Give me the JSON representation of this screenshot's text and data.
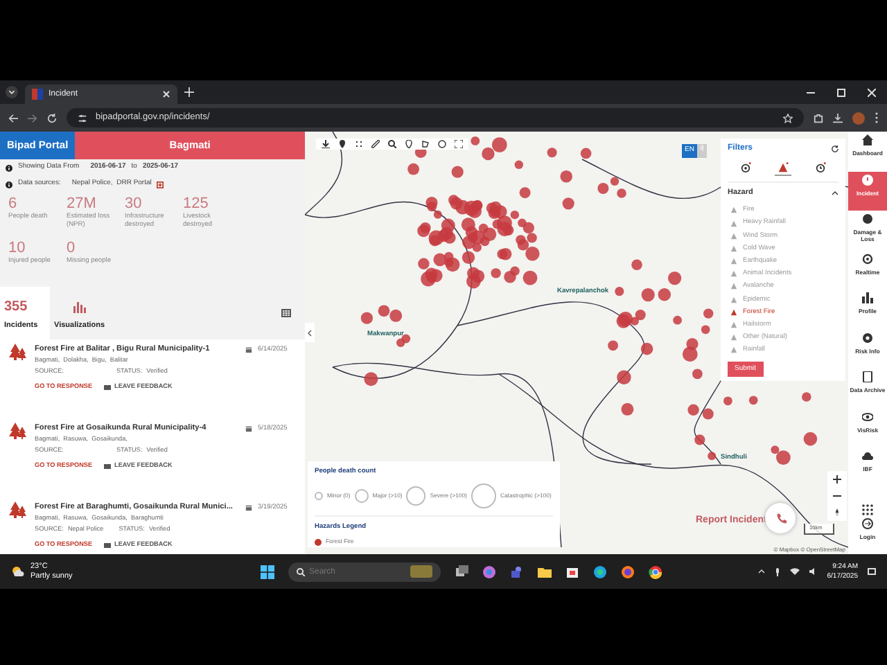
{
  "browser": {
    "tab_title": "Incident",
    "url": "bipadportal.gov.np/incidents/"
  },
  "header": {
    "brand": "Bipad Portal",
    "region": "Bagmati"
  },
  "date_range": {
    "label": "Showing Data From",
    "from": "2016-06-17",
    "to_label": "to",
    "to": "2025-06-17"
  },
  "data_sources": {
    "label": "Data sources:",
    "values": "Nepal Police,  DRR Portal"
  },
  "stats": [
    {
      "value": "6",
      "label": "People death"
    },
    {
      "value": "27M",
      "label": "Estimated loss (NPR)"
    },
    {
      "value": "30",
      "label": "Infrastructure destroyed"
    },
    {
      "value": "125",
      "label": "Livestock destroyed"
    },
    {
      "value": "10",
      "label": "Injured people"
    },
    {
      "value": "0",
      "label": "Missing people"
    }
  ],
  "tabs": [
    {
      "kind": "count",
      "value": "355",
      "label": "Incidents",
      "selected": true
    },
    {
      "kind": "chart",
      "label": "Visualizations",
      "selected": false
    }
  ],
  "incidents": [
    {
      "title": "Forest Fire at Balitar , Bigu Rural Municipality-1",
      "date": "6/14/2025",
      "location": "Bagmati,  Dolakha,  Bigu,  Balitar",
      "source_label": "SOURCE:",
      "status_label": "STATUS:",
      "status": "Verified",
      "response": "GO TO RESPONSE",
      "feedback": "LEAVE FEEDBACK"
    },
    {
      "title": "Forest Fire at Gosaikunda Rural Municipality-4",
      "date": "5/18/2025",
      "location": "Bagmati,  Rasuwa,  Gosaikunda,",
      "source_label": "SOURCE:",
      "status_label": "STATUS:",
      "status": "Verified",
      "response": "GO TO RESPONSE",
      "feedback": "LEAVE FEEDBACK"
    },
    {
      "title": "Forest Fire at Baraghumti, Gosaikunda Rural Munici...",
      "date": "3/19/2025",
      "location": "Bagmati,  Rasuwa,  Gosaikunda,  Baraghumti",
      "source_label": "SOURCE:",
      "source": "Nepal Police",
      "status_label": "STATUS:",
      "status": "Verified",
      "response": "GO TO RESPONSE",
      "feedback": "LEAVE FEEDBACK"
    }
  ],
  "map": {
    "place_labels": [
      "Makwanpur",
      "Kavrepalanchok",
      "Sindhuli"
    ],
    "language": [
      {
        "label": "EN",
        "selected": true
      },
      {
        "label": "ने",
        "selected": false
      }
    ],
    "report": "Report Incident",
    "scale": "10km",
    "attribution": "© Mapbox © OpenStreetMap"
  },
  "filters": {
    "title": "Filters",
    "tabs": [
      {
        "kind": "location",
        "selected": false
      },
      {
        "kind": "hazard",
        "selected": true
      },
      {
        "kind": "time",
        "selected": false
      }
    ],
    "section": "Hazard",
    "hazards": [
      {
        "label": "Fire",
        "selected": false
      },
      {
        "label": "Heavy Rainfall",
        "selected": false
      },
      {
        "label": "Wind Storm",
        "selected": false
      },
      {
        "label": "Cold Wave",
        "selected": false
      },
      {
        "label": "Earthquake",
        "selected": false
      },
      {
        "label": "Animal Incidents",
        "selected": false
      },
      {
        "label": "Avalanche",
        "selected": false
      },
      {
        "label": "Epidemic",
        "selected": false
      },
      {
        "label": "Forest Fire",
        "selected": true
      },
      {
        "label": "Hailstorm",
        "selected": false
      },
      {
        "label": "Other (Natural)",
        "selected": false
      },
      {
        "label": "Rainfall",
        "selected": false
      }
    ],
    "submit": "Submit"
  },
  "legend": {
    "title": "People death count",
    "levels": [
      "Minor (0)",
      "Major (>10)",
      "Severe (>100)",
      "Catastrophic (>100)"
    ],
    "hazards_title": "Hazards Legend",
    "hazards": [
      {
        "label": "Forest Fire",
        "color": "#c0392b"
      }
    ]
  },
  "nav": [
    {
      "label": "Dashboard",
      "selected": false
    },
    {
      "label": "Incident",
      "selected": true
    },
    {
      "label": "Damage & Loss",
      "selected": false
    },
    {
      "label": "Realtime",
      "selected": false
    },
    {
      "label": "Profile",
      "selected": false
    },
    {
      "label": "Risk Info",
      "selected": false
    },
    {
      "label": "Data Archive",
      "selected": false
    },
    {
      "label": "VisRisk",
      "selected": false
    },
    {
      "label": "IBF",
      "selected": false
    },
    {
      "label": "Login",
      "selected": false
    }
  ],
  "taskbar": {
    "temperature": "23°C",
    "weather": "Partly sunny",
    "search": {
      "placeholder": "Search"
    },
    "time": "9:24 AM",
    "date": "6/17/2025"
  }
}
